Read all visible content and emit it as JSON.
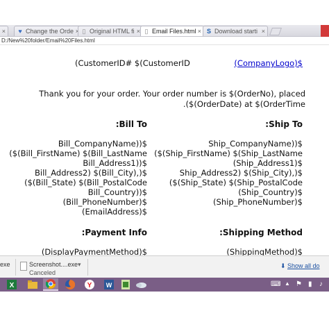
{
  "browser": {
    "tabs": [
      {
        "label": "Change the Orde",
        "icon": "heart-icon",
        "active": false
      },
      {
        "label": "Original HTML fi",
        "icon": "page-icon",
        "active": false
      },
      {
        "label": "Email Files.html",
        "icon": "page-icon",
        "active": true
      },
      {
        "label": "Download starti",
        "icon": "s-logo-icon",
        "active": false
      }
    ],
    "close_glyph": "×",
    "address": "D:/New%20folder/Email%20Files.html"
  },
  "page": {
    "customer_id_line": "(CustomerID# $(CustomerID",
    "company_logo_link": "(CompanyLogo)$",
    "thanks_line1": "Thank you for your order. Your order number is $(OrderNo), placed",
    "thanks_line2": ".($(OrderDate) at $(OrderTime",
    "bill_to": {
      "heading": ":Bill To",
      "lines": [
        "Bill_CompanyName))$",
        "($(Bill_FirstName) $(Bill_LastName",
        "Bill_Address1))$",
        "Bill_Address2) $(Bill_City),)$",
        "($(Bill_State) $(Bill_PostalCode",
        "Bill_Country))$",
        "(Bill_PhoneNumber)$",
        "(EmailAddress)$"
      ]
    },
    "ship_to": {
      "heading": ":Ship To",
      "lines": [
        "Ship_CompanyName))$",
        "($(Ship_FirstName) $(Ship_LastName",
        "(Ship_Address1)$",
        "Ship_Address2) $(Ship_City),)$",
        "($(Ship_State) $(Ship_PostalCode",
        "(Ship_Country)$",
        "(Ship_PhoneNumber)$"
      ]
    },
    "payment_info": {
      "heading": ":Payment Info",
      "value": "(DisplayPaymentMethod)$"
    },
    "shipping_method": {
      "heading": ":Shipping Method",
      "value": "(ShippingMethod)$"
    }
  },
  "downloads": {
    "first_item_label": "exe",
    "item": {
      "name": "Screenshot....exe",
      "status": "Canceled"
    },
    "arrow_glyph": "▾",
    "show_all": "Show all do"
  },
  "taskbar": {
    "apps": [
      "excel-icon",
      "file-explorer-icon",
      "chrome-icon",
      "firefox-icon",
      "yandex-icon",
      "word-icon",
      "green-app-icon",
      "onedrive-icon"
    ],
    "tray_glyph": "⌨"
  },
  "colors": {
    "link": "#0000cc",
    "taskbar": "#7a5e86",
    "close_button": "#d23a3a"
  }
}
